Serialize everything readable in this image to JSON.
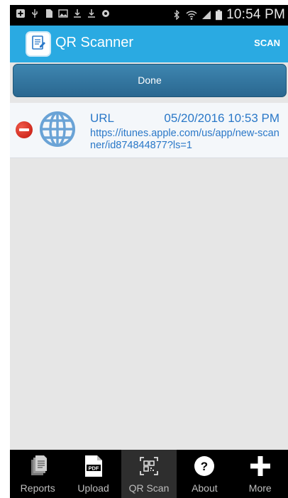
{
  "status_bar": {
    "time": "10:54 PM",
    "icons": [
      "add-icon",
      "usb-icon",
      "sd-card-icon",
      "image-icon",
      "download-icon",
      "download-icon",
      "sync-icon",
      "bluetooth-icon",
      "wifi-icon",
      "signal-icon",
      "battery-icon"
    ]
  },
  "action_bar": {
    "title": "QR Scanner",
    "scan_label": "SCAN",
    "background": "#2aaae2"
  },
  "done_bar": {
    "label": "Done"
  },
  "list": {
    "items": [
      {
        "type": "URL",
        "date": "05/20/2016 10:53 PM",
        "value": "https://itunes.apple.com/us/app/new-scanner/id874844877?ls=1",
        "icon": "globe-icon"
      }
    ]
  },
  "tabs": [
    {
      "label": "Reports",
      "icon": "reports-icon"
    },
    {
      "label": "Upload",
      "icon": "pdf-icon"
    },
    {
      "label": "QR Scan",
      "icon": "qr-code-icon",
      "active": true
    },
    {
      "label": "About",
      "icon": "question-icon"
    },
    {
      "label": "More",
      "icon": "plus-icon"
    }
  ]
}
